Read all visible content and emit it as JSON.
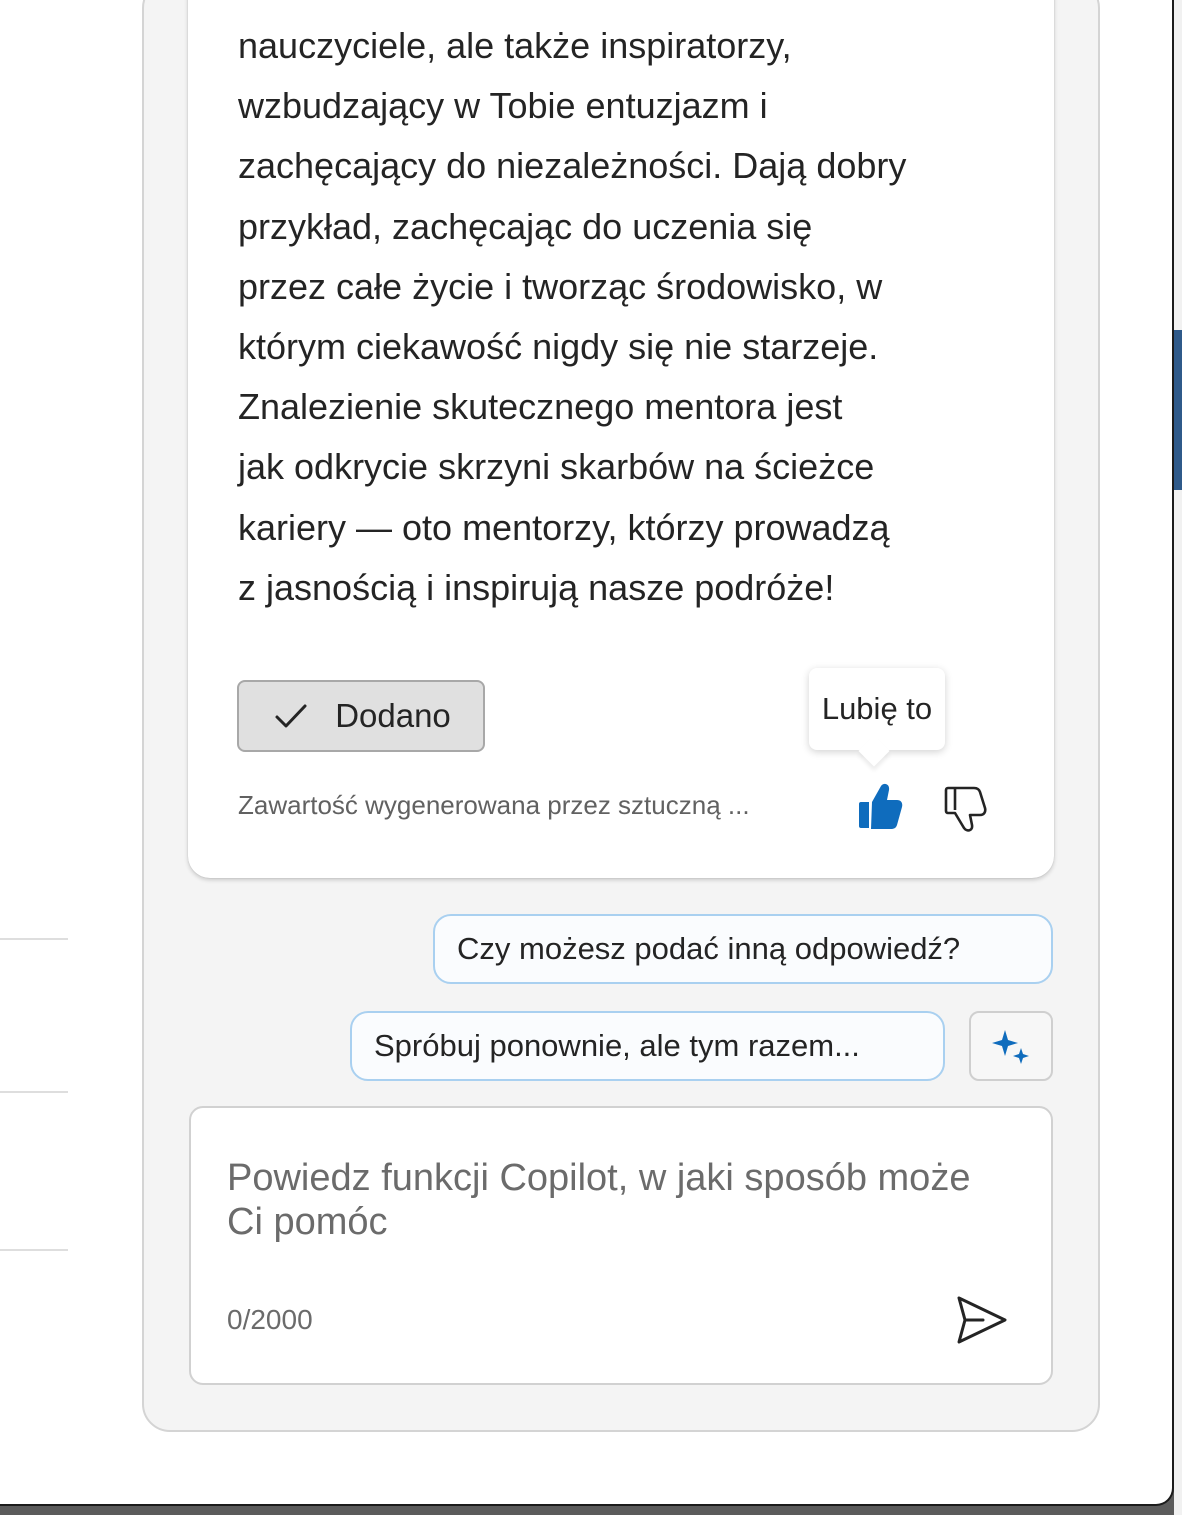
{
  "answer": {
    "text": "nauczyciele, ale także inspiratorzy,\nwzbudzający w Tobie entuzjazm i\nzachęcający do niezależności. Dają dobry\nprzykład, zachęcając do uczenia się\nprzez całe życie i tworząc środowisko, w\nktórym ciekawość nigdy się nie starzeje.\nZnalezienie skutecznego mentora jest\njak odkrycie skrzyni skarbów na ścieżce\nkariery — oto mentorzy, którzy prowadzą\nz jasnością i inspirują nasze podróże!"
  },
  "actions": {
    "added_label": "Dodano",
    "tooltip": "Lubię to",
    "disclaimer": "Zawartość wygenerowana przez sztuczną ..."
  },
  "suggestions": [
    {
      "label": "Czy możesz podać inną odpowiedź?"
    },
    {
      "label": "Spróbuj ponownie, ale tym razem..."
    }
  ],
  "composer": {
    "placeholder": "Powiedz funkcji Copilot, w jaki sposób może Ci pomóc",
    "counter": "0/2000"
  },
  "icons": {
    "added": "checkmark-icon",
    "like": "thumbs-up-filled-icon",
    "dislike": "thumbs-down-icon",
    "prompts": "sparkle-icon",
    "send": "send-icon"
  },
  "colors": {
    "accent": "#0f6cbd",
    "suggestion_border": "#a9d0f0"
  }
}
